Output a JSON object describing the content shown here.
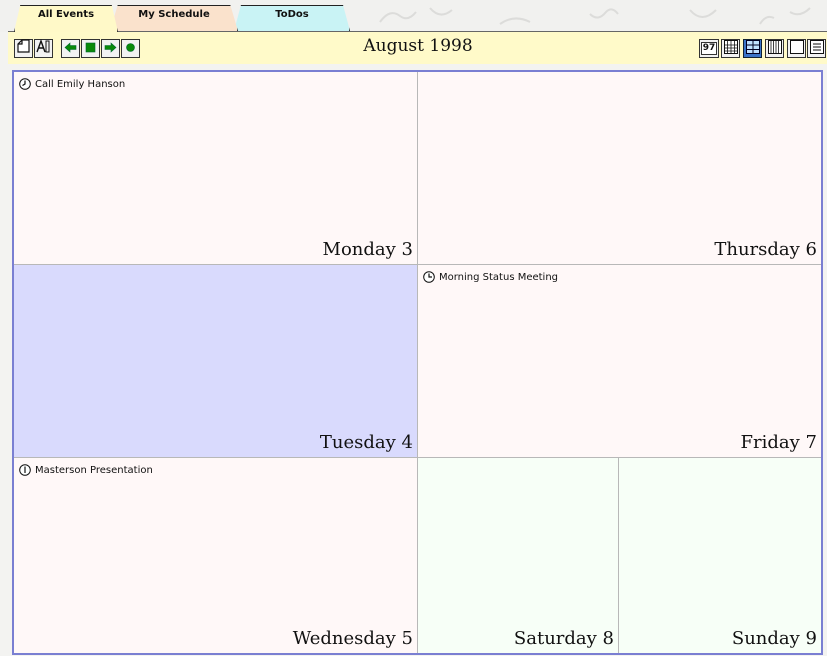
{
  "tabs": [
    {
      "label": "All Events",
      "active": true,
      "color": "#fff9c8"
    },
    {
      "label": "My Schedule",
      "active": false,
      "color": "#fae2cc"
    },
    {
      "label": "ToDos",
      "active": false,
      "color": "#c9f3f5"
    }
  ],
  "toolbar": {
    "title": "August 1998",
    "left_buttons": [
      "new-note-icon",
      "font-icon",
      "back-arrow-icon",
      "today-square-icon",
      "forward-arrow-icon",
      "record-circle-icon"
    ],
    "view_buttons": [
      "year-view-icon",
      "month-view-icon",
      "week-view-icon",
      "columns-view-icon",
      "day-view-icon",
      "list-view-icon"
    ],
    "year_label": "97",
    "selected_view": "week-view-icon"
  },
  "days": {
    "monday": {
      "label": "Monday 3",
      "event": "Call Emily Hanson"
    },
    "tuesday": {
      "label": "Tuesday 4",
      "event": ""
    },
    "wednesday": {
      "label": "Wednesday 5",
      "event": "Masterson Presentation"
    },
    "thursday": {
      "label": "Thursday 6",
      "event": ""
    },
    "friday": {
      "label": "Friday 7",
      "event": "Morning Status Meeting"
    },
    "saturday": {
      "label": "Saturday 8",
      "event": ""
    },
    "sunday": {
      "label": "Sunday 9",
      "event": ""
    }
  },
  "colors": {
    "accent_border": "#7a7fd2",
    "selected_cell": "#d9dafd",
    "weekday_cell": "#fff8f8",
    "weekend_cell": "#f7fff7",
    "toolbar_bg": "#fffac9",
    "arrow_green": "#0a8a0a"
  }
}
